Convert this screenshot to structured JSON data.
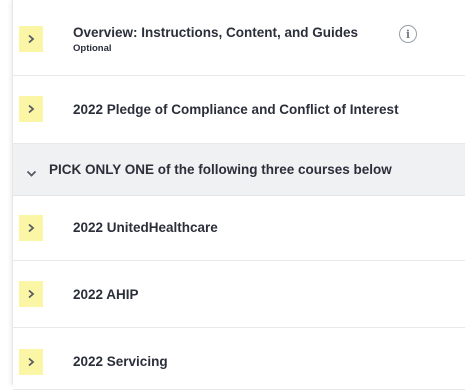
{
  "items": [
    {
      "label": "Overview: Instructions, Content, and Guides",
      "sublabel": "Optional",
      "icon": "chevron-right-icon"
    },
    {
      "label": "2022 Pledge of Compliance and Conflict of Interest",
      "icon": "chevron-right-icon"
    }
  ],
  "section": {
    "label": "PICK ONLY ONE of the following three courses below",
    "icon": "chevron-down-icon"
  },
  "courses": [
    {
      "label": "2022 UnitedHealthcare",
      "icon": "chevron-right-icon"
    },
    {
      "label": "2022 AHIP",
      "icon": "chevron-right-icon"
    },
    {
      "label": "2022 Servicing",
      "icon": "chevron-right-icon"
    }
  ],
  "info_glyph": "i",
  "colors": {
    "chevron_bg": "#fbf6a5",
    "section_bg": "#f0f1f3",
    "text": "#2b2f3a"
  }
}
